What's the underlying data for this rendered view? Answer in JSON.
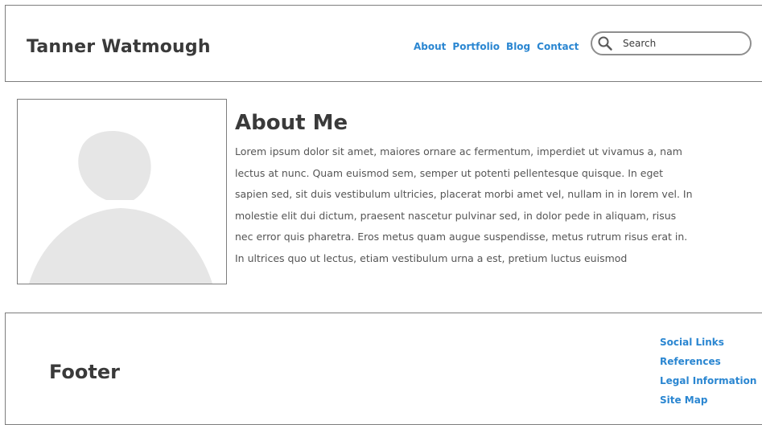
{
  "header": {
    "site_title": "Tanner Watmough",
    "nav": [
      {
        "label": "About"
      },
      {
        "label": "Portfolio"
      },
      {
        "label": "Blog"
      },
      {
        "label": "Contact"
      }
    ],
    "search": {
      "placeholder": "Search",
      "icon": "search-icon"
    }
  },
  "main": {
    "avatar_icon": "person-placeholder-icon",
    "heading": "About Me",
    "body": "Lorem ipsum dolor sit amet, maiores ornare ac fermentum, imperdiet ut vivamus a, nam lectus at nunc. Quam euismod sem, semper ut potenti pellentesque quisque. In eget sapien sed, sit duis vestibulum ultricies, placerat morbi amet vel, nullam in in lorem vel. In molestie elit dui dictum, praesent nascetur pulvinar sed, in dolor pede in aliquam, risus nec error quis pharetra. Eros metus quam augue suspendisse, metus rutrum risus erat in.  In ultrices quo ut lectus, etiam vestibulum urna a est, pretium luctus euismod"
  },
  "footer": {
    "title": "Footer",
    "links": [
      {
        "label": "Social Links"
      },
      {
        "label": "References"
      },
      {
        "label": "Legal Information"
      },
      {
        "label": "Site Map"
      }
    ]
  },
  "colors": {
    "link": "#2a86d1",
    "border": "#7d7d7d",
    "placeholder_fill": "#e6e6e6"
  }
}
